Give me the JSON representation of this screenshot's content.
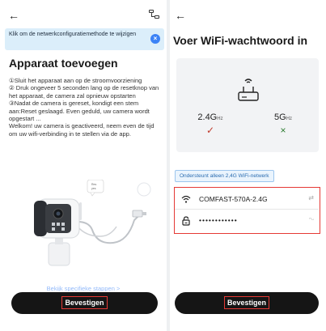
{
  "left": {
    "back_glyph": "←",
    "tip": "Klik om de netwerkconfiguratiemethode te wijzigen",
    "tip_close": "×",
    "title": "Apparaat toevoegen",
    "steps": "①Sluit het apparaat aan op de stroomvoorziening\n② Druk ongeveer 5 seconden lang op de resetknop van het apparaat, de camera zal opnieuw opstarten\n③Nadat de camera is gereset, kondigt een stem aan:Reset geslaagd. Even geduld, uw camera wordt opgestart ...\nWelkom! uw camera is geactiveerd, neem even de tijd om uw wifi-verbinding in te stellen via de app.",
    "reset_bubble": "Res\nyes",
    "link": "Bekijk specifieke stappen >",
    "confirm": "Bevestigen"
  },
  "right": {
    "back_glyph": "←",
    "title": "Voer WiFi-wachtwoord in",
    "band_24": "2.4G",
    "band_24_unit": "Hz",
    "band_5": "5G",
    "band_5_unit": "Hz",
    "mark_ok": "✓",
    "mark_no": "×",
    "support_tag": "Ondersteunt alleen 2,4G WiFi-netwerk",
    "ssid": "COMFAST-570A-2.4G",
    "password": "••••••••••••",
    "swap_glyph": "⇄",
    "eye_glyph": "ᵔᵕ",
    "confirm": "Bevestigen"
  },
  "colors": {
    "accent": "#3b82f6",
    "button": "#151515",
    "highlight": "#e53935",
    "ok": "#c0392b",
    "no": "#2e7d32"
  }
}
